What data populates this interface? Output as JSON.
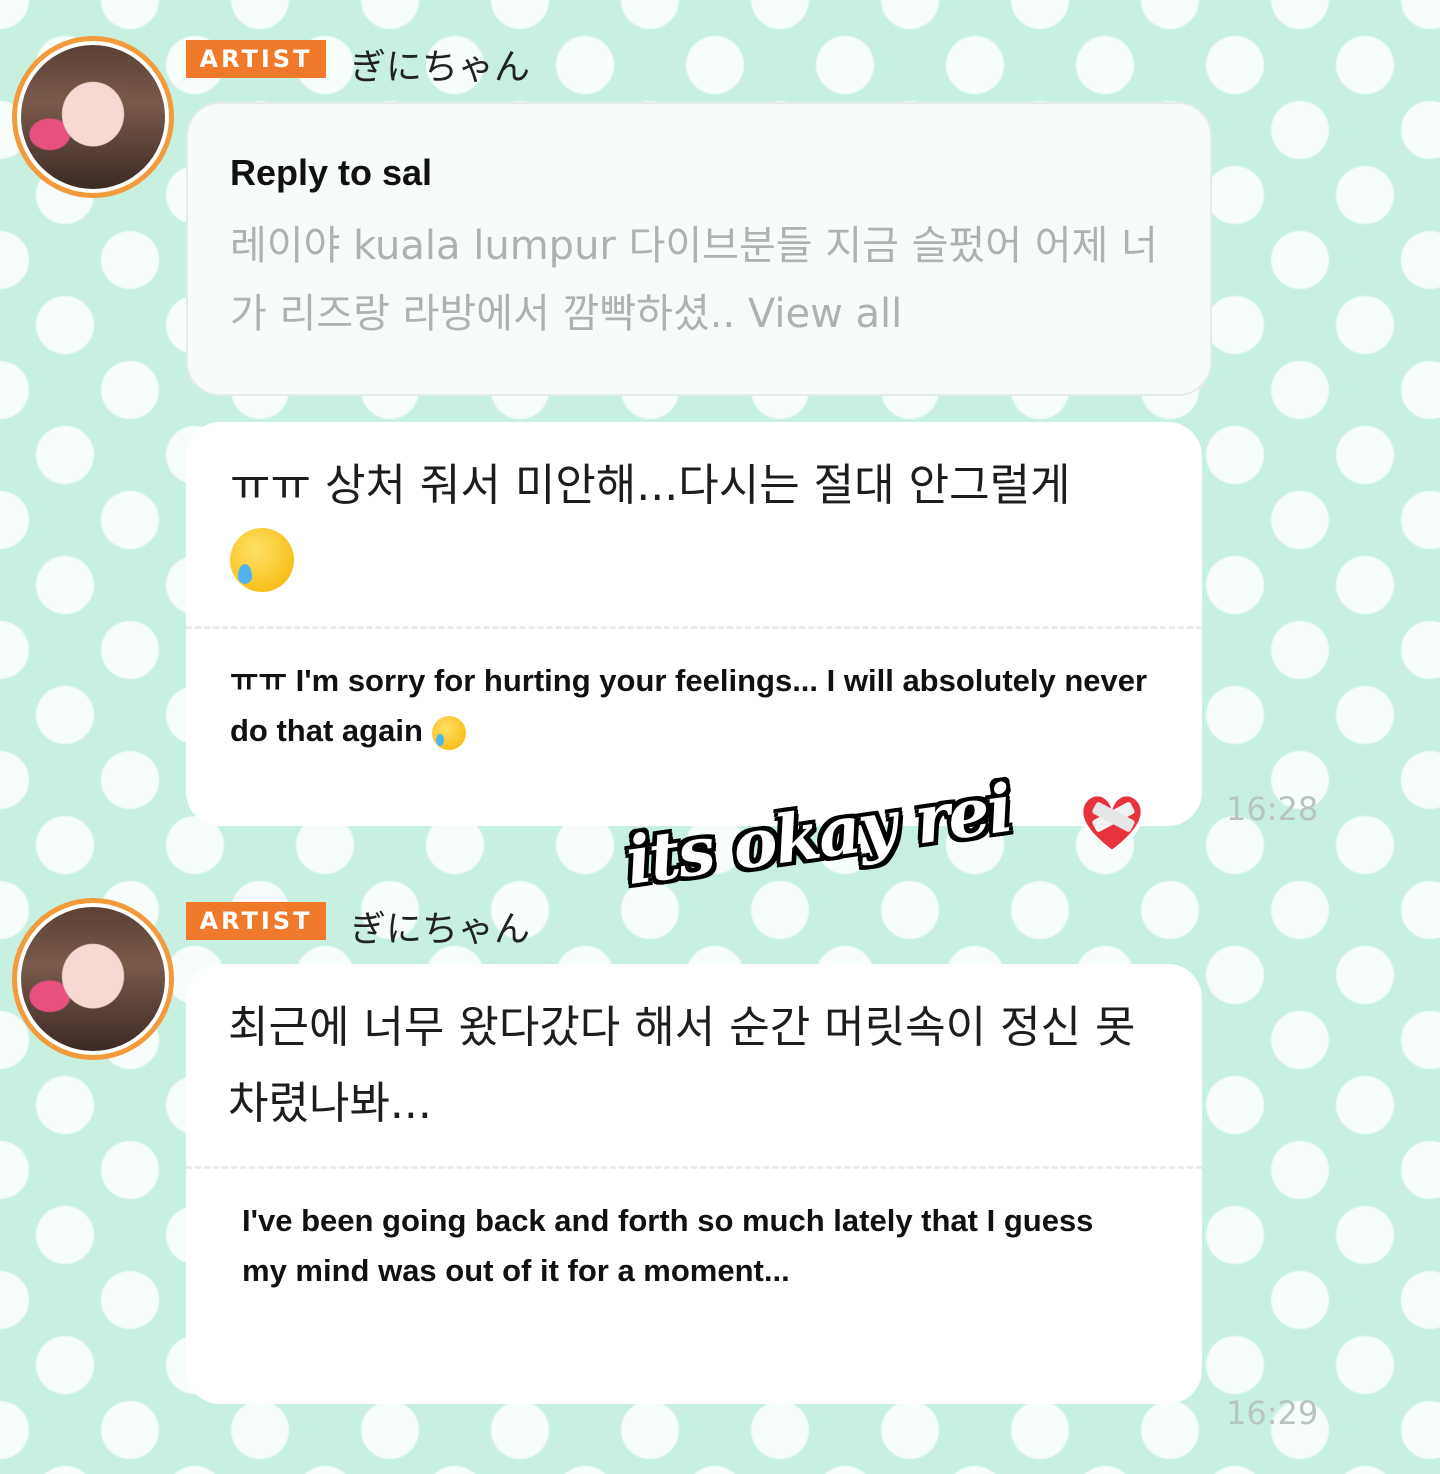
{
  "messages": [
    {
      "badge": "ARTIST",
      "name": "ぎにちゃん",
      "reply": {
        "title": "Reply to sal",
        "body": "레이야 kuala lumpur 다이브분들 지금 슬펐어 어제 너가 리즈랑 라방에서 깜빡하셨.. View all"
      },
      "korean": "ㅠㅠ 상처 줘서 미안해...다시는 절대 안그럴게",
      "translation": "ㅠㅠ I'm sorry for hurting your feelings... I will absolutely never do that again",
      "time": "16:28"
    },
    {
      "badge": "ARTIST",
      "name": "ぎにちゃん",
      "korean": "최근에 너무 왔다갔다 해서 순간 머릿속이 정신 못 차렸나봐...",
      "translation": "I've been going back and forth so much lately that I guess my mind was out of it for a moment...",
      "time": "16:29"
    }
  ],
  "sticker": {
    "text": "its okay rei",
    "emoji": "mending-heart-icon"
  },
  "colors": {
    "background": "#c7f0e0",
    "badge": "#f07a2a",
    "avatar_ring": "#f39a3a"
  }
}
